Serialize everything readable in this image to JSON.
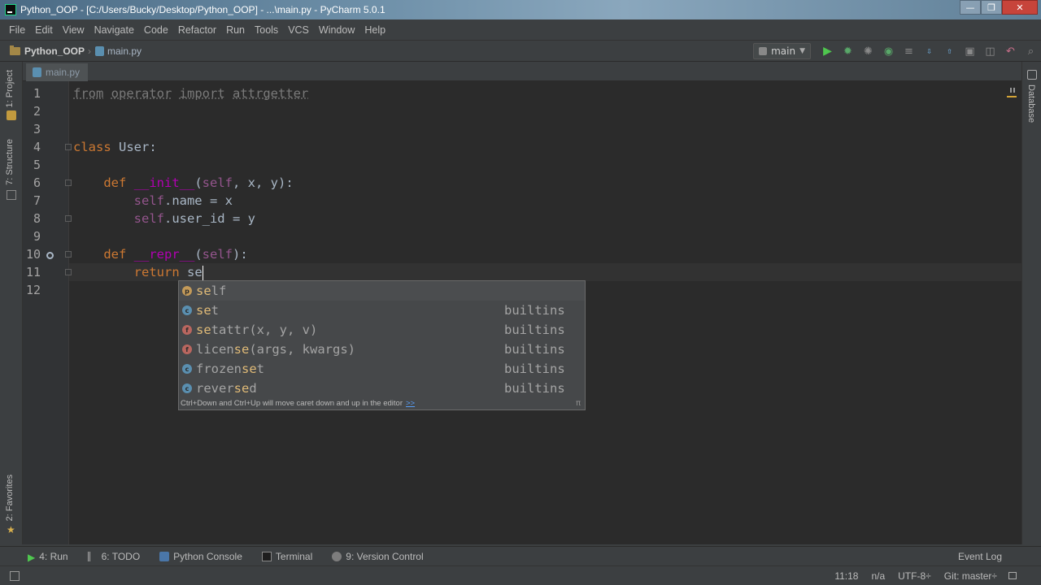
{
  "window": {
    "title": "Python_OOP - [C:/Users/Bucky/Desktop/Python_OOP] - ...\\main.py - PyCharm 5.0.1",
    "controls": {
      "minimize": "—",
      "maximize": "❐",
      "close": "✕"
    }
  },
  "menu": [
    "File",
    "Edit",
    "View",
    "Navigate",
    "Code",
    "Refactor",
    "Run",
    "Tools",
    "VCS",
    "Window",
    "Help"
  ],
  "navbar": {
    "project": "Python_OOP",
    "file": "main.py",
    "run_config": "main"
  },
  "left_tools": {
    "project": "1: Project",
    "structure": "7: Structure",
    "favorites": "2: Favorites"
  },
  "right_tools": {
    "database": "Database"
  },
  "editor_tab": {
    "label": "main.py"
  },
  "editor": {
    "line_numbers": [
      "1",
      "2",
      "3",
      "4",
      "5",
      "6",
      "7",
      "8",
      "9",
      "10",
      "11",
      "12"
    ],
    "lines": {
      "l1": {
        "kw_from": "from",
        "mod": "operator",
        "kw_import": "import",
        "name": "attrgetter"
      },
      "l4": {
        "kw": "class",
        "rest": " User:"
      },
      "l6": {
        "kw": "def",
        "name": "__init__",
        "p1": "(",
        "self": "self",
        "rest": ", x, y):"
      },
      "l7": {
        "self": "self",
        "rest": ".name = x"
      },
      "l8": {
        "self": "self",
        "rest": ".user_id = y"
      },
      "l10": {
        "kw": "def",
        "name": "__repr__",
        "p1": "(",
        "self": "self",
        "rest": "):"
      },
      "l11": {
        "kw": "return",
        "typed": "se"
      }
    }
  },
  "completion": {
    "items": [
      {
        "kind": "p",
        "pre": "",
        "match": "se",
        "post": "lf",
        "type": ""
      },
      {
        "kind": "c",
        "pre": "",
        "match": "se",
        "post": "t",
        "type": "builtins"
      },
      {
        "kind": "f",
        "pre": "",
        "match": "se",
        "post": "tattr(x, y, v)",
        "type": "builtins"
      },
      {
        "kind": "f",
        "pre": "licen",
        "match": "se",
        "post": "(args, kwargs)",
        "type": "builtins"
      },
      {
        "kind": "c",
        "pre": "frozen",
        "match": "se",
        "post": "t",
        "type": "builtins"
      },
      {
        "kind": "c",
        "pre": "rever",
        "match": "se",
        "post": "d",
        "type": "builtins"
      }
    ],
    "hint": "Ctrl+Down and Ctrl+Up will move caret down and up in the editor",
    "hint_more": ">>",
    "pi": "π"
  },
  "tool_windows": {
    "run": "4: Run",
    "todo": "6: TODO",
    "console": "Python Console",
    "terminal": "Terminal",
    "vcs": "9: Version Control",
    "event_log": "Event Log"
  },
  "status": {
    "position": "11:18",
    "na": "n/a",
    "encoding": "UTF-8÷",
    "git": "Git: master÷"
  }
}
